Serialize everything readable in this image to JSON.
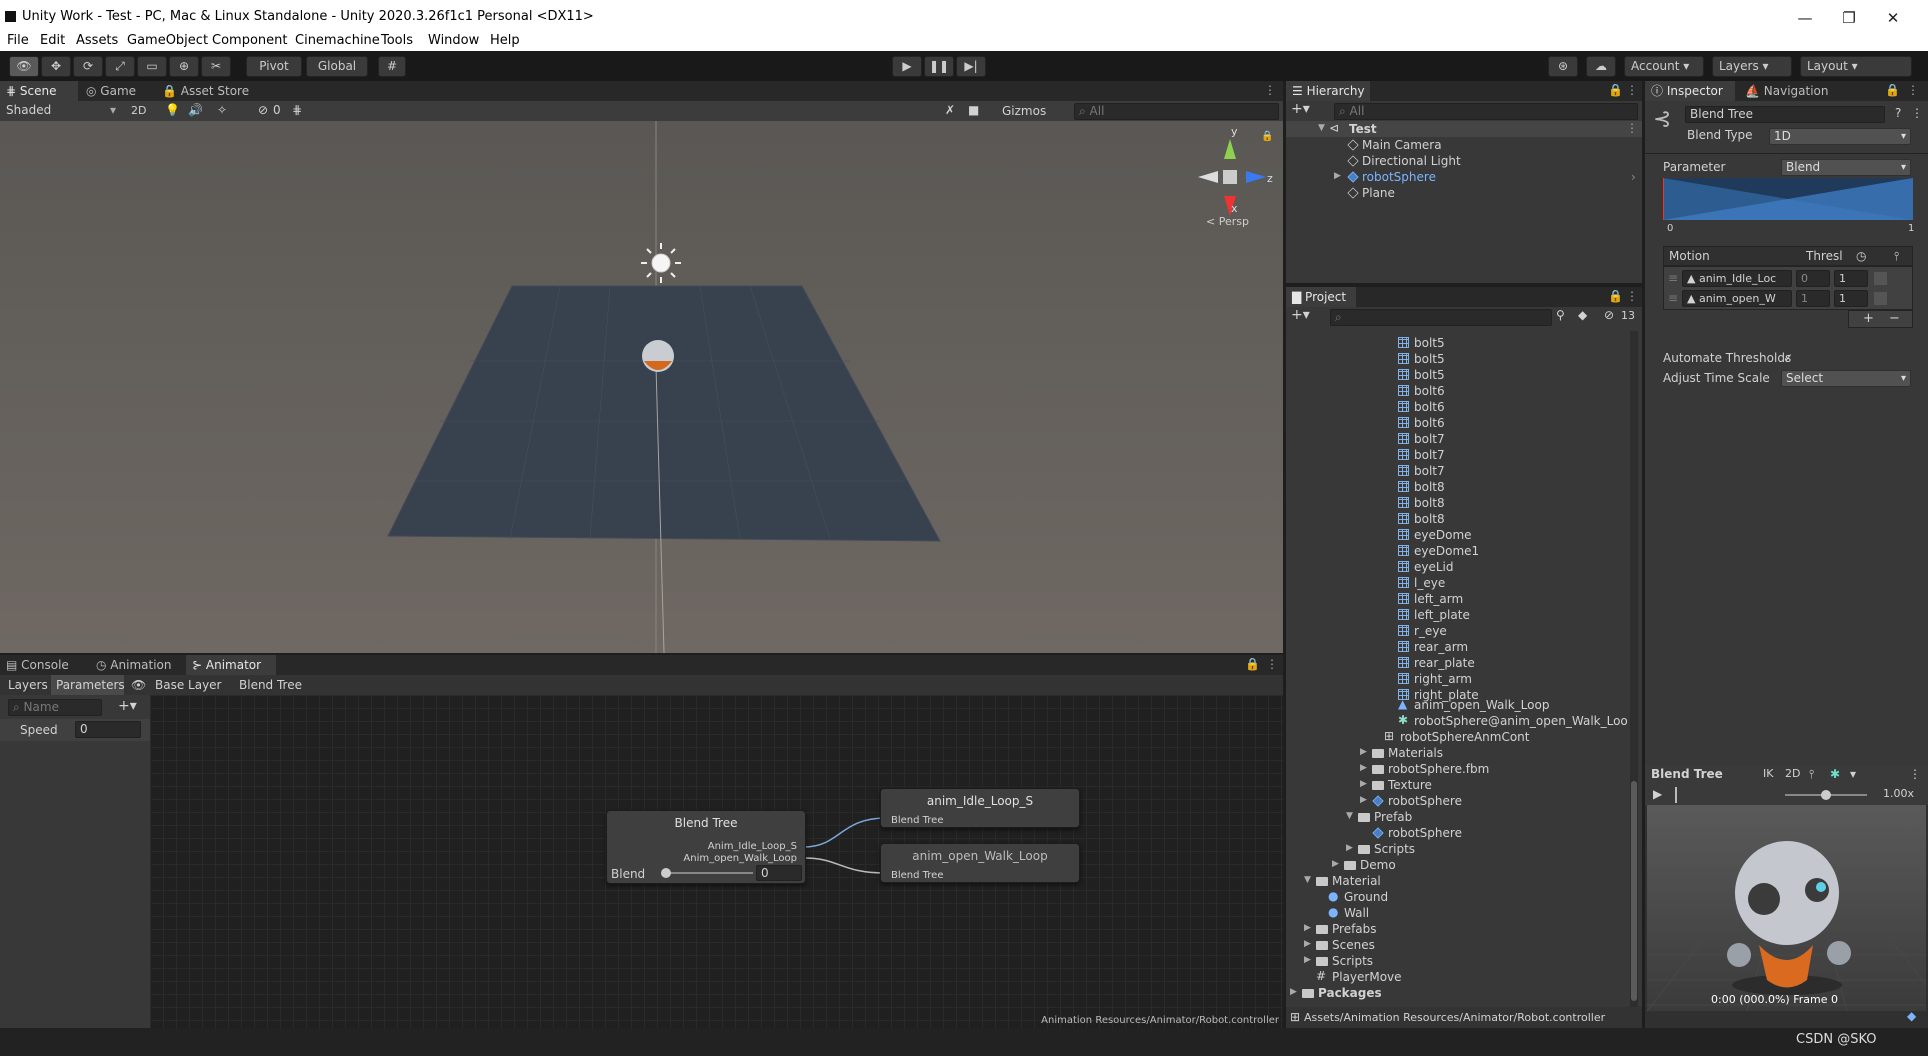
{
  "window": {
    "title": "Unity Work - Test - PC, Mac & Linux Standalone - Unity 2020.3.26f1c1 Personal <DX11>",
    "min": "—",
    "max": "❐",
    "close": "✕"
  },
  "menu": [
    "File",
    "Edit",
    "Assets",
    "GameObject",
    "Component",
    "Cinemachine",
    "Tools",
    "Window",
    "Help"
  ],
  "toolbar": {
    "pivot": "Pivot",
    "global": "Global",
    "account": "Account",
    "layers": "Layers",
    "layout": "Layout"
  },
  "scene": {
    "tabs": [
      "Scene",
      "Game",
      "Asset Store"
    ],
    "shading": "Shaded",
    "mode2d": "2D",
    "hidden_count": "0",
    "gizmos": "Gizmos",
    "search": "All",
    "persp": "< Persp",
    "axis_y": "y",
    "axis_x": "x",
    "axis_z": "z"
  },
  "animator": {
    "tabs": [
      "Console",
      "Animation",
      "Animator"
    ],
    "sub_tabs": [
      "Layers",
      "Parameters"
    ],
    "breadcrumb": [
      "Base Layer",
      "Blend Tree"
    ],
    "name_placeholder": "Name",
    "param_name": "Speed",
    "param_value": "0",
    "blend_node": {
      "title": "Blend Tree",
      "out1": "Anim_Idle_Loop_S",
      "out2": "Anim_open_Walk_Loop",
      "param": "Blend",
      "value": "0"
    },
    "idle_node": {
      "title": "anim_Idle_Loop_S",
      "sub": "Blend Tree"
    },
    "walk_node": {
      "title": "anim_open_Walk_Loop",
      "sub": "Blend Tree"
    },
    "path": "Animation Resources/Animator/Robot.controller"
  },
  "hierarchy": {
    "title": "Hierarchy",
    "search": "All",
    "root": "Test",
    "items": [
      "Main Camera",
      "Directional Light",
      "robotSphere",
      "Plane"
    ]
  },
  "project": {
    "title": "Project",
    "count": "13",
    "files": [
      "bolt5",
      "bolt5",
      "bolt5",
      "bolt6",
      "bolt6",
      "bolt6",
      "bolt7",
      "bolt7",
      "bolt7",
      "bolt8",
      "bolt8",
      "bolt8",
      "eyeDome",
      "eyeDome1",
      "eyeLid",
      "l_eye",
      "left_arm",
      "left_plate",
      "r_eye",
      "rear_arm",
      "rear_plate",
      "right_arm",
      "right_plate"
    ],
    "anim1": "anim_open_Walk_Loop",
    "anim2": "robotSphere@anim_open_Walk_LoopA",
    "ctrl": "robotSphereAnmCont",
    "folders1": [
      "Materials",
      "robotSphere.fbm",
      "Texture",
      "robotSphere"
    ],
    "prefab": "Prefab",
    "prefab_item": "robotSphere",
    "scripts": "Scripts",
    "demo": "Demo",
    "material": "Material",
    "mat_items": [
      "Ground",
      "Wall"
    ],
    "roots": [
      "Prefabs",
      "Scenes",
      "Scripts"
    ],
    "player": "PlayerMove",
    "packages": "Packages",
    "path": "Assets/Animation Resources/Animator/Robot.controller"
  },
  "inspector": {
    "tabs": [
      "Inspector",
      "Navigation"
    ],
    "name": "Blend Tree",
    "blend_type_label": "Blend Type",
    "blend_type": "1D",
    "param_label": "Parameter",
    "param": "Blend",
    "range_min": "0",
    "range_max": "1",
    "motion_label": "Motion",
    "thresh_label": "Thresl",
    "motions": [
      {
        "name": "anim_Idle_Loc",
        "thresh": "0",
        "speed": "1"
      },
      {
        "name": "anim_open_W",
        "thresh": "1",
        "speed": "1"
      }
    ],
    "auto_label": "Automate Thresholds",
    "auto_check": "✓",
    "adjust_label": "Adjust Time Scale",
    "adjust": "Select"
  },
  "preview": {
    "title": "Blend Tree",
    "ik": "IK",
    "mode2d": "2D",
    "speed": "1.00x",
    "frame": "0:00 (000.0%) Frame 0",
    "watermark": "CSDN @SKO"
  }
}
